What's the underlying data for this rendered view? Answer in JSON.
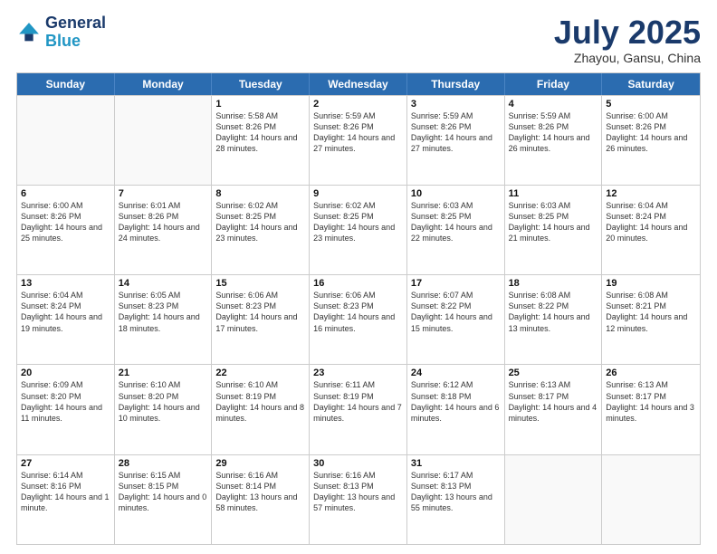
{
  "header": {
    "logo_general": "General",
    "logo_blue": "Blue",
    "month": "July 2025",
    "location": "Zhayou, Gansu, China"
  },
  "days_of_week": [
    "Sunday",
    "Monday",
    "Tuesday",
    "Wednesday",
    "Thursday",
    "Friday",
    "Saturday"
  ],
  "weeks": [
    [
      {
        "day": "",
        "sunrise": "",
        "sunset": "",
        "daylight": ""
      },
      {
        "day": "",
        "sunrise": "",
        "sunset": "",
        "daylight": ""
      },
      {
        "day": "1",
        "sunrise": "Sunrise: 5:58 AM",
        "sunset": "Sunset: 8:26 PM",
        "daylight": "Daylight: 14 hours and 28 minutes."
      },
      {
        "day": "2",
        "sunrise": "Sunrise: 5:59 AM",
        "sunset": "Sunset: 8:26 PM",
        "daylight": "Daylight: 14 hours and 27 minutes."
      },
      {
        "day": "3",
        "sunrise": "Sunrise: 5:59 AM",
        "sunset": "Sunset: 8:26 PM",
        "daylight": "Daylight: 14 hours and 27 minutes."
      },
      {
        "day": "4",
        "sunrise": "Sunrise: 5:59 AM",
        "sunset": "Sunset: 8:26 PM",
        "daylight": "Daylight: 14 hours and 26 minutes."
      },
      {
        "day": "5",
        "sunrise": "Sunrise: 6:00 AM",
        "sunset": "Sunset: 8:26 PM",
        "daylight": "Daylight: 14 hours and 26 minutes."
      }
    ],
    [
      {
        "day": "6",
        "sunrise": "Sunrise: 6:00 AM",
        "sunset": "Sunset: 8:26 PM",
        "daylight": "Daylight: 14 hours and 25 minutes."
      },
      {
        "day": "7",
        "sunrise": "Sunrise: 6:01 AM",
        "sunset": "Sunset: 8:26 PM",
        "daylight": "Daylight: 14 hours and 24 minutes."
      },
      {
        "day": "8",
        "sunrise": "Sunrise: 6:02 AM",
        "sunset": "Sunset: 8:25 PM",
        "daylight": "Daylight: 14 hours and 23 minutes."
      },
      {
        "day": "9",
        "sunrise": "Sunrise: 6:02 AM",
        "sunset": "Sunset: 8:25 PM",
        "daylight": "Daylight: 14 hours and 23 minutes."
      },
      {
        "day": "10",
        "sunrise": "Sunrise: 6:03 AM",
        "sunset": "Sunset: 8:25 PM",
        "daylight": "Daylight: 14 hours and 22 minutes."
      },
      {
        "day": "11",
        "sunrise": "Sunrise: 6:03 AM",
        "sunset": "Sunset: 8:25 PM",
        "daylight": "Daylight: 14 hours and 21 minutes."
      },
      {
        "day": "12",
        "sunrise": "Sunrise: 6:04 AM",
        "sunset": "Sunset: 8:24 PM",
        "daylight": "Daylight: 14 hours and 20 minutes."
      }
    ],
    [
      {
        "day": "13",
        "sunrise": "Sunrise: 6:04 AM",
        "sunset": "Sunset: 8:24 PM",
        "daylight": "Daylight: 14 hours and 19 minutes."
      },
      {
        "day": "14",
        "sunrise": "Sunrise: 6:05 AM",
        "sunset": "Sunset: 8:23 PM",
        "daylight": "Daylight: 14 hours and 18 minutes."
      },
      {
        "day": "15",
        "sunrise": "Sunrise: 6:06 AM",
        "sunset": "Sunset: 8:23 PM",
        "daylight": "Daylight: 14 hours and 17 minutes."
      },
      {
        "day": "16",
        "sunrise": "Sunrise: 6:06 AM",
        "sunset": "Sunset: 8:23 PM",
        "daylight": "Daylight: 14 hours and 16 minutes."
      },
      {
        "day": "17",
        "sunrise": "Sunrise: 6:07 AM",
        "sunset": "Sunset: 8:22 PM",
        "daylight": "Daylight: 14 hours and 15 minutes."
      },
      {
        "day": "18",
        "sunrise": "Sunrise: 6:08 AM",
        "sunset": "Sunset: 8:22 PM",
        "daylight": "Daylight: 14 hours and 13 minutes."
      },
      {
        "day": "19",
        "sunrise": "Sunrise: 6:08 AM",
        "sunset": "Sunset: 8:21 PM",
        "daylight": "Daylight: 14 hours and 12 minutes."
      }
    ],
    [
      {
        "day": "20",
        "sunrise": "Sunrise: 6:09 AM",
        "sunset": "Sunset: 8:20 PM",
        "daylight": "Daylight: 14 hours and 11 minutes."
      },
      {
        "day": "21",
        "sunrise": "Sunrise: 6:10 AM",
        "sunset": "Sunset: 8:20 PM",
        "daylight": "Daylight: 14 hours and 10 minutes."
      },
      {
        "day": "22",
        "sunrise": "Sunrise: 6:10 AM",
        "sunset": "Sunset: 8:19 PM",
        "daylight": "Daylight: 14 hours and 8 minutes."
      },
      {
        "day": "23",
        "sunrise": "Sunrise: 6:11 AM",
        "sunset": "Sunset: 8:19 PM",
        "daylight": "Daylight: 14 hours and 7 minutes."
      },
      {
        "day": "24",
        "sunrise": "Sunrise: 6:12 AM",
        "sunset": "Sunset: 8:18 PM",
        "daylight": "Daylight: 14 hours and 6 minutes."
      },
      {
        "day": "25",
        "sunrise": "Sunrise: 6:13 AM",
        "sunset": "Sunset: 8:17 PM",
        "daylight": "Daylight: 14 hours and 4 minutes."
      },
      {
        "day": "26",
        "sunrise": "Sunrise: 6:13 AM",
        "sunset": "Sunset: 8:17 PM",
        "daylight": "Daylight: 14 hours and 3 minutes."
      }
    ],
    [
      {
        "day": "27",
        "sunrise": "Sunrise: 6:14 AM",
        "sunset": "Sunset: 8:16 PM",
        "daylight": "Daylight: 14 hours and 1 minute."
      },
      {
        "day": "28",
        "sunrise": "Sunrise: 6:15 AM",
        "sunset": "Sunset: 8:15 PM",
        "daylight": "Daylight: 14 hours and 0 minutes."
      },
      {
        "day": "29",
        "sunrise": "Sunrise: 6:16 AM",
        "sunset": "Sunset: 8:14 PM",
        "daylight": "Daylight: 13 hours and 58 minutes."
      },
      {
        "day": "30",
        "sunrise": "Sunrise: 6:16 AM",
        "sunset": "Sunset: 8:13 PM",
        "daylight": "Daylight: 13 hours and 57 minutes."
      },
      {
        "day": "31",
        "sunrise": "Sunrise: 6:17 AM",
        "sunset": "Sunset: 8:13 PM",
        "daylight": "Daylight: 13 hours and 55 minutes."
      },
      {
        "day": "",
        "sunrise": "",
        "sunset": "",
        "daylight": ""
      },
      {
        "day": "",
        "sunrise": "",
        "sunset": "",
        "daylight": ""
      }
    ]
  ]
}
